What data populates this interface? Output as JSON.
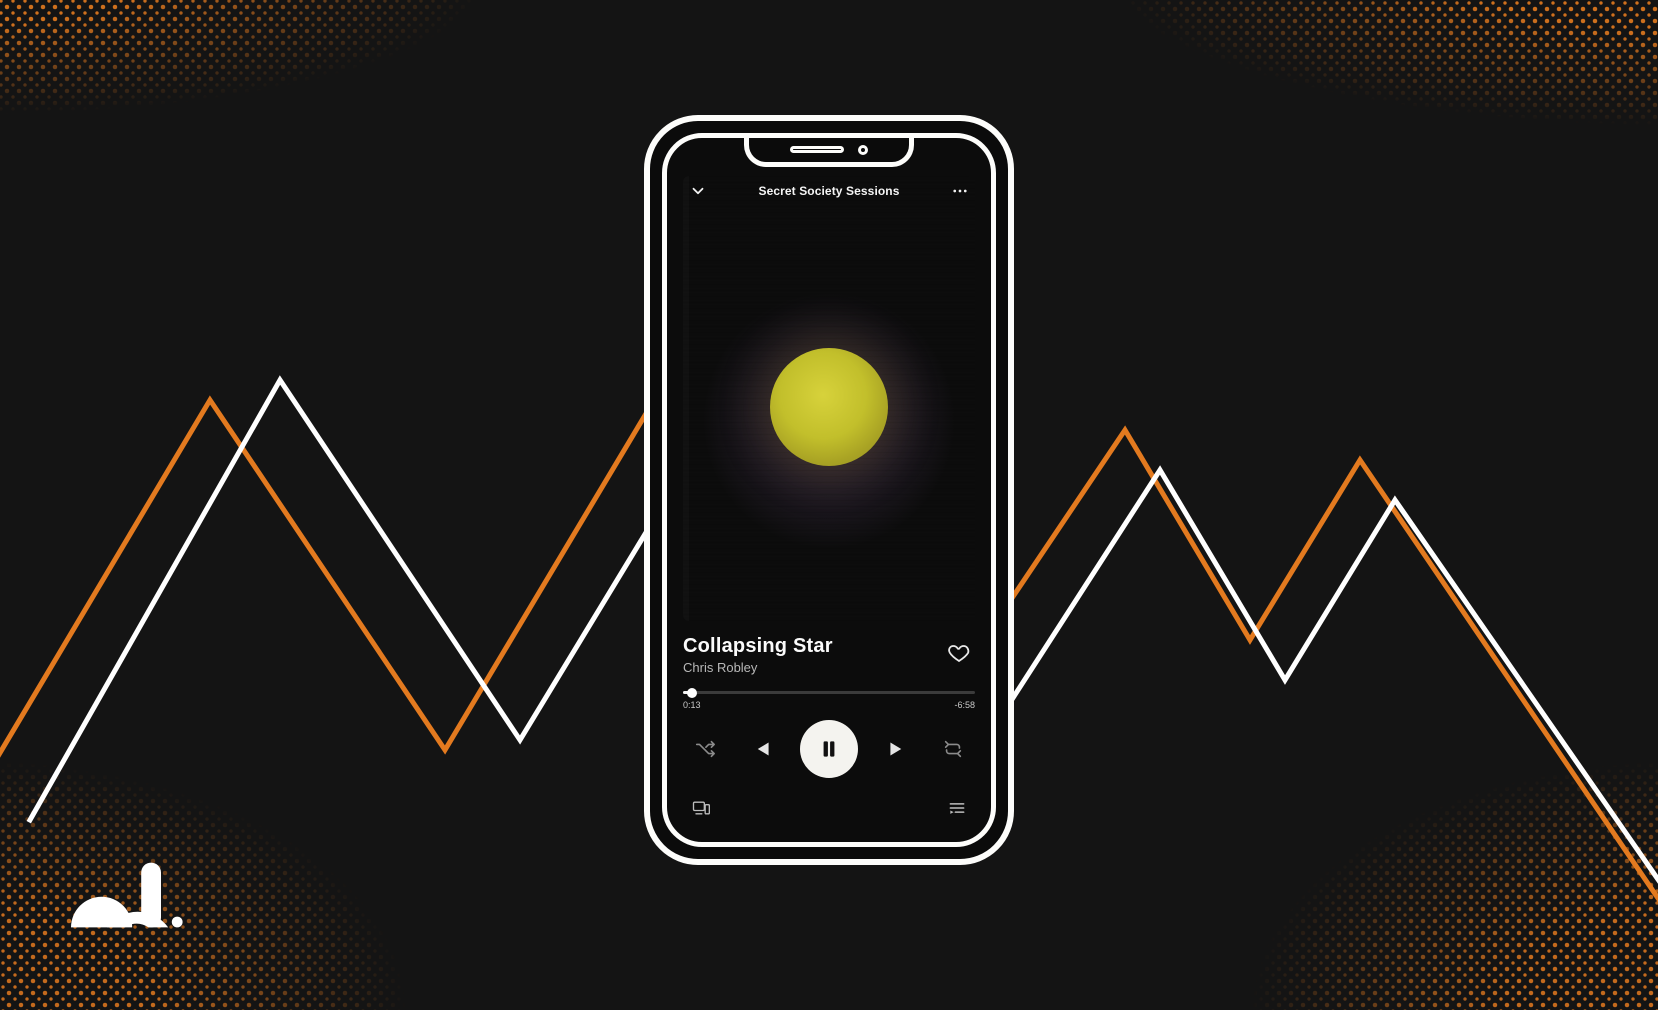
{
  "colors": {
    "accent_orange": "#e37a1f",
    "phone_outline": "#fdfdfb",
    "bg": "#141414"
  },
  "player": {
    "header": {
      "playlist_title": "Secret Society Sessions"
    },
    "track": {
      "title": "Collapsing Star",
      "artist": "Chris Robley"
    },
    "progress": {
      "elapsed_label": "0:13",
      "remaining_label": "-6:58",
      "percent": 3.0
    },
    "icons": {
      "collapse": "chevron-down-icon",
      "more": "more-icon",
      "like": "heart-icon",
      "shuffle": "shuffle-icon",
      "previous": "previous-icon",
      "play_pause": "pause-icon",
      "next": "next-icon",
      "repeat": "repeat-icon",
      "devices": "devices-icon",
      "queue": "queue-icon"
    }
  }
}
